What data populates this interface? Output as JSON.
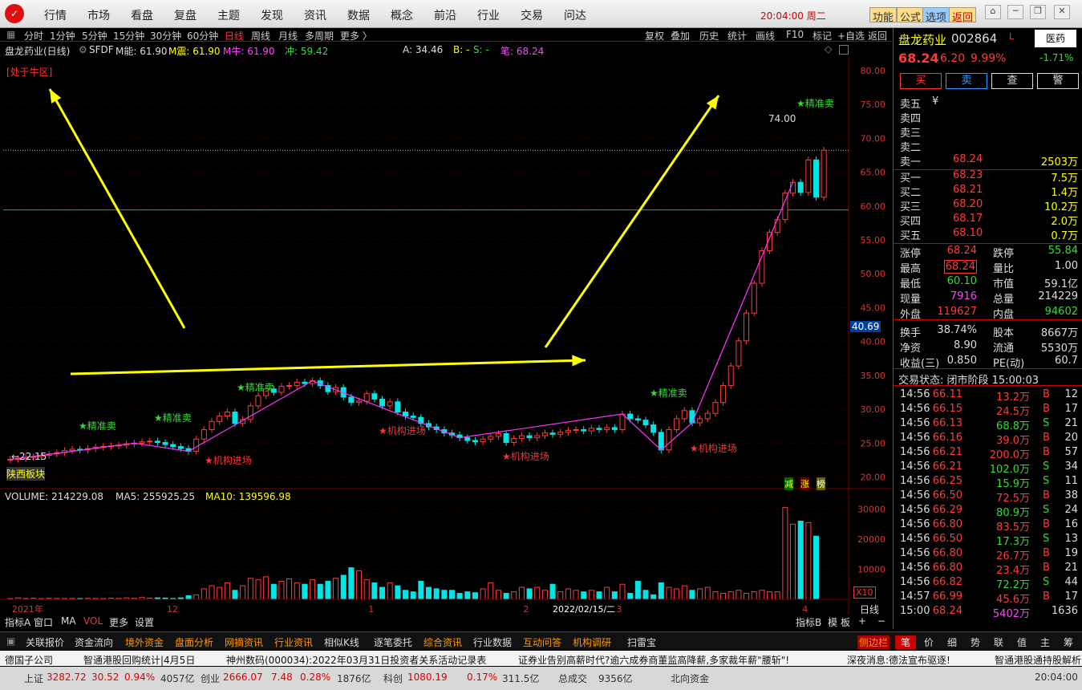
{
  "menu": {
    "items": [
      "行情",
      "市场",
      "看盘",
      "复盘",
      "主题",
      "发现",
      "资讯",
      "数据",
      "概念",
      "前沿",
      "行业",
      "交易",
      "问达"
    ],
    "clock": "20:04:00 周二",
    "tags": [
      "功能",
      "公式",
      "选项",
      "返回"
    ]
  },
  "periods": {
    "items": [
      "分时",
      "1分钟",
      "5分钟",
      "15分钟",
      "30分钟",
      "60分钟",
      "日线",
      "周线",
      "月线",
      "多周期",
      "更多 〉"
    ],
    "tools": [
      "复权",
      "叠加",
      "历史",
      "统计",
      "画线",
      "F10",
      "标记",
      "+自选",
      "返回"
    ]
  },
  "info": {
    "title": "盘龙药业(日线)",
    "sfdf": "SFDF",
    "m_neng": "M能: 61.90",
    "m_zhen": "M震: 61.90",
    "m_niu": "M牛: 61.90",
    "zhong": "冲: 59.42",
    "a": "A: 34.46",
    "b": "B: -",
    "s": "S: -",
    "bi": "笔: 68.24"
  },
  "chart_data": [
    {
      "type": "candlestick",
      "title": "盘龙药业(日线)",
      "x_ticks": [
        "2021年",
        "12",
        "1",
        "2",
        "2022/02/15/二",
        "3",
        "4"
      ],
      "y_ticks": [
        "80.00",
        "75.00",
        "70.00",
        "65.00",
        "60.00",
        "55.00",
        "50.00",
        "45.00",
        "40.00",
        "35.00",
        "30.00",
        "25.00",
        "20.00"
      ],
      "ylim": [
        19,
        82
      ],
      "current_price_tag": "40.69",
      "marker_high": "74.00",
      "marker_low": "←22.15",
      "series": [
        {
          "name": "close",
          "values": [
            22.6,
            22.7,
            22.9,
            23.0,
            23.2,
            23.4,
            23.6,
            23.9,
            24.1,
            24.0,
            24.2,
            24.4,
            24.5,
            24.6,
            24.7,
            24.9,
            25.0,
            25.2,
            25.3,
            25.1,
            24.8,
            24.5,
            24.2,
            23.8,
            25.6,
            27.0,
            28.2,
            29.0,
            29.6,
            27.9,
            28.5,
            30.5,
            32.0,
            33.0,
            32.5,
            33.4,
            33.5,
            34.0,
            33.8,
            34.2,
            33.5,
            32.6,
            33.2,
            31.8,
            31.0,
            31.2,
            32.3,
            31.5,
            30.5,
            31.1,
            29.6,
            29.0,
            28.8,
            27.9,
            27.4,
            27.0,
            26.5,
            26.2,
            25.8,
            25.4,
            25.2,
            25.6,
            26.0,
            26.4,
            25.1,
            25.7,
            26.1,
            25.8,
            26.1,
            26.5,
            26.3,
            26.6,
            26.9,
            27.0,
            26.8,
            27.2,
            27.0,
            27.3,
            27.0,
            29.3,
            28.6,
            28.4,
            27.7,
            26.6,
            24.0,
            27.0,
            28.6,
            29.8,
            28.0,
            28.6,
            29.4,
            31.0,
            33.5,
            36.4,
            40.1,
            44.2,
            48.6,
            53.4,
            56.1,
            58.0,
            61.9,
            63.5,
            62.0,
            66.8,
            61.3,
            68.24
          ]
        },
        {
          "name": "volume",
          "values": [
            250,
            500,
            300,
            400,
            250,
            350,
            300,
            280,
            300,
            260,
            320,
            300,
            250,
            400,
            300,
            500,
            350,
            600,
            400,
            500,
            450,
            300,
            500,
            1200,
            1500,
            3500,
            4500,
            4000,
            5500,
            3000,
            4500,
            7000,
            6500,
            7500,
            5000,
            6000,
            6800,
            5500,
            5000,
            6500,
            5000,
            6000,
            7000,
            8000,
            10500,
            9500,
            6500,
            5500,
            4000,
            5500,
            4500,
            3000,
            2500,
            6000,
            4000,
            3500,
            3000,
            3000,
            2000,
            2500,
            2200,
            3500,
            5500,
            3000,
            2000,
            2500,
            4000,
            3500,
            4000,
            3000,
            5000,
            2500,
            3500,
            3000,
            2500,
            3000,
            2500,
            4000,
            2500,
            5000,
            2000,
            6000,
            3000,
            1500,
            5500,
            4000,
            3500,
            4500,
            3000,
            3500,
            4000,
            2500,
            2000,
            2500,
            3000,
            2000,
            2500,
            3000,
            2500,
            2500,
            30500,
            25000,
            26000,
            25500,
            21000
          ]
        }
      ]
    }
  ],
  "annot": {
    "niu": "[处于牛区]",
    "sector": "陕西板块",
    "jz": "★精准卖",
    "jg": "★机构进场",
    "jz_top": "★精准卖",
    "x10": "X10",
    "rzd": "日线",
    "jian": "减",
    "zhang": "涨",
    "bang": "榜"
  },
  "volume_info": {
    "vol": "VOLUME: 214229.08",
    "ma5": "MA5: 255925.25",
    "ma10": "MA10: 139596.98",
    "ticks": [
      "30000",
      "20000",
      "10000"
    ]
  },
  "tabs": [
    "指标A",
    "窗口",
    "MA",
    "VOL",
    "更多",
    "设置"
  ],
  "tabs_right": [
    "指标B",
    "模",
    "板",
    "+",
    "−"
  ],
  "stock": {
    "name": "盘龙药业",
    "code": "002864",
    "tag": "L",
    "price": "68.24",
    "chg": "6.20",
    "pct": "9.99%",
    "sector": "医药",
    "sector_pct": "-1.71%",
    "btns": [
      "买",
      "卖",
      "查",
      "警"
    ]
  },
  "orderbook": {
    "sell": [
      [
        "卖五",
        "¥",
        ""
      ],
      [
        "卖四",
        "",
        ""
      ],
      [
        "卖三",
        "",
        ""
      ],
      [
        "卖二",
        "",
        ""
      ],
      [
        "卖一",
        "68.24",
        "2503万"
      ]
    ],
    "buy": [
      [
        "买一",
        "68.23",
        "7.5万"
      ],
      [
        "买二",
        "68.21",
        "1.4万"
      ],
      [
        "买三",
        "68.20",
        "10.2万"
      ],
      [
        "买四",
        "68.17",
        "2.0万"
      ],
      [
        "买五",
        "68.10",
        "0.7万"
      ]
    ]
  },
  "stats": [
    [
      "涨停",
      "68.24",
      "跌停",
      "55.84"
    ],
    [
      "最高",
      "68.24",
      "量比",
      "1.00"
    ],
    [
      "最低",
      "60.10",
      "市值",
      "59.1亿"
    ],
    [
      "现量",
      "7916",
      "总量",
      "214229"
    ],
    [
      "外盘",
      "119627",
      "内盘",
      "94602"
    ],
    [
      "换手",
      "38.74%",
      "股本",
      "8667万"
    ],
    [
      "净资",
      "8.90",
      "流通",
      "5530万"
    ],
    [
      "收益(三)",
      "0.850",
      "PE(动)",
      "60.7"
    ]
  ],
  "trade_status": "交易状态: 闭市阶段 15:00:03",
  "trades": [
    [
      "14:56",
      "66.11",
      "13.2万",
      "B",
      "12"
    ],
    [
      "14:56",
      "66.15",
      "24.5万",
      "B",
      "17"
    ],
    [
      "14:56",
      "66.13",
      "68.8万",
      "S",
      "21"
    ],
    [
      "14:56",
      "66.16",
      "39.0万",
      "B",
      "20"
    ],
    [
      "14:56",
      "66.21",
      "200.0万",
      "B",
      "57"
    ],
    [
      "14:56",
      "66.21",
      "102.0万",
      "S",
      "34"
    ],
    [
      "14:56",
      "66.25",
      "15.9万",
      "S",
      "11"
    ],
    [
      "14:56",
      "66.50",
      "72.5万",
      "B",
      "38"
    ],
    [
      "14:56",
      "66.29",
      "80.9万",
      "S",
      "24"
    ],
    [
      "14:56",
      "66.80",
      "83.5万",
      "B",
      "16"
    ],
    [
      "14:56",
      "66.50",
      "17.3万",
      "S",
      "13"
    ],
    [
      "14:56",
      "66.80",
      "26.7万",
      "B",
      "19"
    ],
    [
      "14:56",
      "66.80",
      "23.4万",
      "B",
      "21"
    ],
    [
      "14:56",
      "66.82",
      "72.2万",
      "S",
      "44"
    ],
    [
      "14:57",
      "66.99",
      "45.6万",
      "B",
      "17"
    ],
    [
      "15:00",
      "68.24",
      "5402万",
      "",
      "1636"
    ]
  ],
  "toolbar2": [
    "关联报价",
    "资金流向",
    "境外资金",
    "盘面分析",
    "网摘资讯",
    "行业资讯",
    "相似K线",
    "逐笔委托",
    "综合资讯",
    "行业数据",
    "互动问答",
    "机构调研",
    "扫雷宝",
    "侧边栏"
  ],
  "toolbar2_right": [
    "笔",
    "价",
    "细",
    "势",
    "联",
    "值",
    "主",
    "筹"
  ],
  "news": [
    "德国子公司",
    "智通港股回购统计|4月5日",
    "神州数码(000034):2022年03月31日投资者关系活动记录表",
    "证券业告别高薪时代?逾六成券商董监高降薪,多家裁年薪\"腰斩\"!",
    "深夜消息:德法宣布驱逐!",
    "智通港股通持股解析"
  ],
  "ticker": {
    "sh": "上证",
    "sh_val": "3282.72",
    "sh_chg": "30.52",
    "sh_pct": "0.94%",
    "sh_amt": "4057亿",
    "cy": "创业",
    "cy_val": "2666.07",
    "cy_chg": "7.48",
    "cy_pct": "0.28%",
    "cy_amt": "1876亿",
    "kc": "科创",
    "kc_val": "1080.19",
    "kc_pct": "0.17%",
    "kc_amt": "311.5亿",
    "total": "总成交",
    "total_amt": "9356亿",
    "north": "北向资金",
    "time": "20:04:00"
  }
}
